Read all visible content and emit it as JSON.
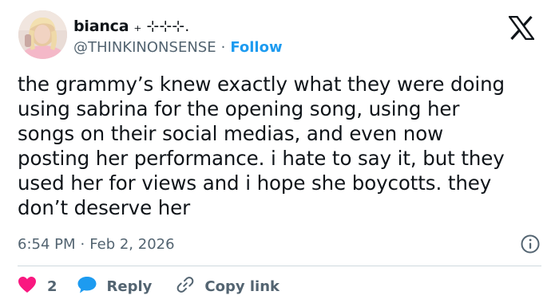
{
  "author": {
    "display_name": "bianca",
    "name_suffix": "₊ ⊹⊹⊹.",
    "handle": "@THINKINONSENSE",
    "separator": "·",
    "follow_label": "Follow"
  },
  "tweet": {
    "text": "the grammy’s knew exactly what they were doing\nusing sabrina for the opening song, using her\nsongs on their social medias, and even now\nposting her performance. i hate to say it, but they\nused her for views and i hope she boycotts. they\ndon’t deserve her",
    "time": "6:54 PM",
    "separator": "·",
    "date": "Feb 2, 2026"
  },
  "actions": {
    "like_count": "2",
    "reply_label": "Reply",
    "copy_label": "Copy link"
  },
  "icons": {
    "brand": "x-logo-icon",
    "info": "info-icon",
    "like": "heart-icon",
    "reply": "speech-bubble-icon",
    "copy": "link-icon"
  },
  "colors": {
    "text": "#0f1419",
    "muted": "#536471",
    "accent": "#1d9bf0",
    "like": "#f91880",
    "divider": "#cfd9de"
  }
}
